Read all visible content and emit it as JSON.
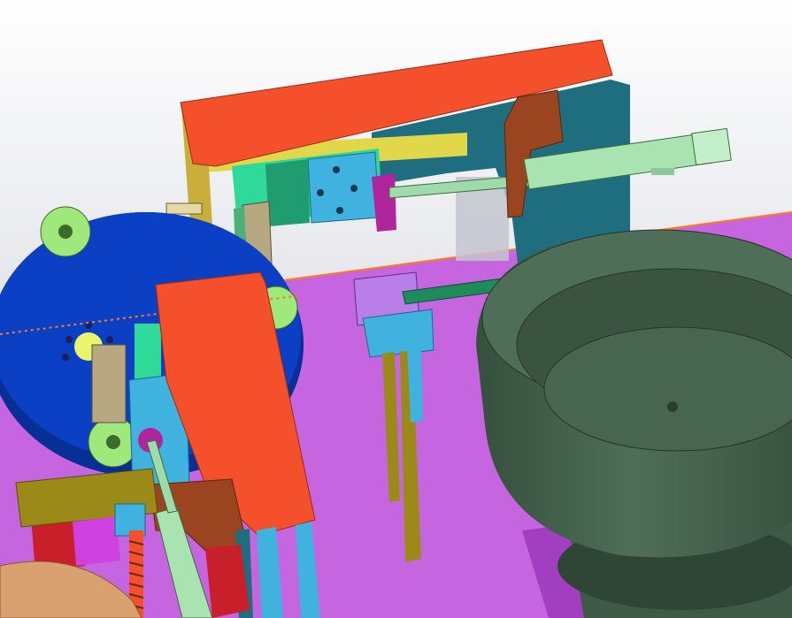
{
  "scene": {
    "description_visible_text": "",
    "colors": {
      "background_top": "#ffffff",
      "background_bottom": "#c9cbd6",
      "base_plate": "#c565e0",
      "base_plate_dark": "#a23fc0",
      "rotary_table": "#0b3fc4",
      "rotary_table_edge": "#082f96",
      "orange_plate": "#f4502c",
      "teal_frame": "#1f6e80",
      "light_green": "#9ee87c",
      "mint_cylinder": "#a8e3b0",
      "bowl_dark": "#3f5a46",
      "bowl_light": "#51705a",
      "magenta_block": "#d042e0",
      "cyan_block": "#3fb2e0",
      "brown_bracket": "#9a4520",
      "olive_rod": "#9c8a18",
      "yellow_rail": "#e0d84a",
      "red_base": "#c81f2a",
      "copper_ring": "#d9a070",
      "dashed_orange": "#ff7a1a"
    }
  }
}
